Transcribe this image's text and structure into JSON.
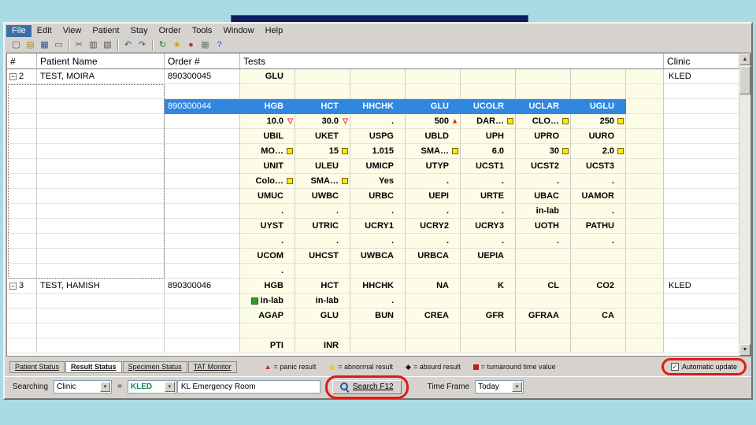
{
  "menu": {
    "items": [
      "File",
      "Edit",
      "View",
      "Patient",
      "Stay",
      "Order",
      "Tools",
      "Window",
      "Help"
    ]
  },
  "toolbar": {
    "icons": [
      {
        "name": "new-document-icon",
        "glyph": "▢",
        "color": "#555555"
      },
      {
        "name": "open-folder-icon",
        "glyph": "▤",
        "color": "#b08a2a"
      },
      {
        "name": "save-icon",
        "glyph": "▦",
        "color": "#35518c"
      },
      {
        "name": "print-icon",
        "glyph": "▭",
        "color": "#555555"
      },
      {
        "sep": true
      },
      {
        "name": "cut-icon",
        "glyph": "✂",
        "color": "#555555"
      },
      {
        "name": "copy-icon",
        "glyph": "▥",
        "color": "#555555"
      },
      {
        "name": "paste-icon",
        "glyph": "▧",
        "color": "#555555"
      },
      {
        "sep": true
      },
      {
        "name": "undo-icon",
        "glyph": "↶",
        "color": "#355a9c"
      },
      {
        "name": "redo-icon",
        "glyph": "↷",
        "color": "#355a9c"
      },
      {
        "sep": true
      },
      {
        "name": "refresh-icon",
        "glyph": "↻",
        "color": "#2a7a2a"
      },
      {
        "name": "favorites-icon",
        "glyph": "★",
        "color": "#c8a800"
      },
      {
        "name": "stop-icon",
        "glyph": "●",
        "color": "#c03030"
      },
      {
        "name": "grid-icon",
        "glyph": "▦",
        "color": "#777777"
      },
      {
        "name": "help-icon",
        "glyph": "?",
        "color": "#2255cc"
      }
    ]
  },
  "grid": {
    "headers": {
      "num": "#",
      "patient": "Patient Name",
      "order": "Order #",
      "tests": "Tests",
      "clinic": "Clinic"
    },
    "rows": [
      {
        "cells": [
          {
            "c": 0,
            "t": "2",
            "expand": true
          },
          {
            "c": 1,
            "t": "TEST, MOIRA"
          },
          {
            "c": 2,
            "t": "890300045"
          },
          {
            "c": 3,
            "t": "GLU"
          },
          {
            "c": 11,
            "t": "KLED"
          }
        ]
      },
      {
        "cells": []
      },
      {
        "hl": true,
        "cells": [
          {
            "c": 2,
            "t": "890300044"
          },
          {
            "c": 3,
            "t": "HGB"
          },
          {
            "c": 4,
            "t": "HCT"
          },
          {
            "c": 5,
            "t": "HHCHK"
          },
          {
            "c": 6,
            "t": "GLU"
          },
          {
            "c": 7,
            "t": "UCOLR"
          },
          {
            "c": 8,
            "t": "UCLAR"
          },
          {
            "c": 9,
            "t": "UGLU"
          }
        ]
      },
      {
        "cells": [
          {
            "c": 3,
            "t": "10.0",
            "m": "rdown"
          },
          {
            "c": 4,
            "t": "30.0",
            "m": "rdown"
          },
          {
            "c": 5,
            "t": "."
          },
          {
            "c": 6,
            "t": "500",
            "m": "rup"
          },
          {
            "c": 7,
            "t": "DAR…",
            "m": "ysq"
          },
          {
            "c": 8,
            "t": "CLO…",
            "m": "ysq"
          },
          {
            "c": 9,
            "t": "250",
            "m": "ysq"
          }
        ]
      },
      {
        "cells": [
          {
            "c": 3,
            "t": "UBIL"
          },
          {
            "c": 4,
            "t": "UKET"
          },
          {
            "c": 5,
            "t": "USPG"
          },
          {
            "c": 6,
            "t": "UBLD"
          },
          {
            "c": 7,
            "t": "UPH"
          },
          {
            "c": 8,
            "t": "UPRO"
          },
          {
            "c": 9,
            "t": "UURO"
          }
        ]
      },
      {
        "cells": [
          {
            "c": 3,
            "t": "MO…",
            "m": "ysq"
          },
          {
            "c": 4,
            "t": "15",
            "m": "ysq"
          },
          {
            "c": 5,
            "t": "1.015"
          },
          {
            "c": 6,
            "t": "SMA…",
            "m": "ysq"
          },
          {
            "c": 7,
            "t": "6.0"
          },
          {
            "c": 8,
            "t": "30",
            "m": "ysq"
          },
          {
            "c": 9,
            "t": "2.0",
            "m": "ysq"
          }
        ]
      },
      {
        "cells": [
          {
            "c": 3,
            "t": "UNIT"
          },
          {
            "c": 4,
            "t": "ULEU"
          },
          {
            "c": 5,
            "t": "UMICP"
          },
          {
            "c": 6,
            "t": "UTYP"
          },
          {
            "c": 7,
            "t": "UCST1"
          },
          {
            "c": 8,
            "t": "UCST2"
          },
          {
            "c": 9,
            "t": "UCST3"
          }
        ]
      },
      {
        "cells": [
          {
            "c": 3,
            "t": "Colo…",
            "m": "ysq"
          },
          {
            "c": 4,
            "t": "SMA…",
            "m": "ysq"
          },
          {
            "c": 5,
            "t": "Yes"
          },
          {
            "c": 6,
            "t": "."
          },
          {
            "c": 7,
            "t": "."
          },
          {
            "c": 8,
            "t": "."
          },
          {
            "c": 9,
            "t": "."
          }
        ]
      },
      {
        "cells": [
          {
            "c": 3,
            "t": "UMUC"
          },
          {
            "c": 4,
            "t": "UWBC"
          },
          {
            "c": 5,
            "t": "URBC"
          },
          {
            "c": 6,
            "t": "UEPI"
          },
          {
            "c": 7,
            "t": "URTE"
          },
          {
            "c": 8,
            "t": "UBAC"
          },
          {
            "c": 9,
            "t": "UAMOR"
          }
        ]
      },
      {
        "cells": [
          {
            "c": 3,
            "t": "."
          },
          {
            "c": 4,
            "t": "."
          },
          {
            "c": 5,
            "t": "."
          },
          {
            "c": 6,
            "t": "."
          },
          {
            "c": 7,
            "t": "."
          },
          {
            "c": 8,
            "t": "in-lab"
          },
          {
            "c": 9,
            "t": "."
          }
        ]
      },
      {
        "cells": [
          {
            "c": 3,
            "t": "UYST"
          },
          {
            "c": 4,
            "t": "UTRIC"
          },
          {
            "c": 5,
            "t": "UCRY1"
          },
          {
            "c": 6,
            "t": "UCRY2"
          },
          {
            "c": 7,
            "t": "UCRY3"
          },
          {
            "c": 8,
            "t": "UOTH"
          },
          {
            "c": 9,
            "t": "PATHU"
          }
        ]
      },
      {
        "cells": [
          {
            "c": 3,
            "t": "."
          },
          {
            "c": 4,
            "t": "."
          },
          {
            "c": 5,
            "t": "."
          },
          {
            "c": 6,
            "t": "."
          },
          {
            "c": 7,
            "t": "."
          },
          {
            "c": 8,
            "t": "."
          },
          {
            "c": 9,
            "t": "."
          }
        ]
      },
      {
        "cells": [
          {
            "c": 3,
            "t": "UCOM"
          },
          {
            "c": 4,
            "t": "UHCST"
          },
          {
            "c": 5,
            "t": "UWBCA"
          },
          {
            "c": 6,
            "t": "URBCA"
          },
          {
            "c": 7,
            "t": "UEPIA"
          }
        ]
      },
      {
        "cells": [
          {
            "c": 3,
            "t": "."
          }
        ]
      },
      {
        "cells": [
          {
            "c": 0,
            "t": "3",
            "expand": true
          },
          {
            "c": 1,
            "t": "TEST, HAMISH"
          },
          {
            "c": 2,
            "t": "890300046"
          },
          {
            "c": 3,
            "t": "HGB"
          },
          {
            "c": 4,
            "t": "HCT"
          },
          {
            "c": 5,
            "t": "HHCHK"
          },
          {
            "c": 6,
            "t": "NA"
          },
          {
            "c": 7,
            "t": "K"
          },
          {
            "c": 8,
            "t": "CL"
          },
          {
            "c": 9,
            "t": "CO2"
          },
          {
            "c": 11,
            "t": "KLED"
          }
        ]
      },
      {
        "cells": [
          {
            "c": 3,
            "t": "in-lab",
            "icon": "green"
          },
          {
            "c": 4,
            "t": "in-lab"
          },
          {
            "c": 5,
            "t": "."
          }
        ]
      },
      {
        "cells": [
          {
            "c": 3,
            "t": "AGAP"
          },
          {
            "c": 4,
            "t": "GLU"
          },
          {
            "c": 5,
            "t": "BUN"
          },
          {
            "c": 6,
            "t": "CREA"
          },
          {
            "c": 7,
            "t": "GFR"
          },
          {
            "c": 8,
            "t": "GFRAA"
          },
          {
            "c": 9,
            "t": "CA"
          }
        ]
      },
      {
        "cells": []
      },
      {
        "cells": [
          {
            "c": 3,
            "t": "PTI"
          },
          {
            "c": 4,
            "t": "INR"
          }
        ]
      }
    ]
  },
  "tabs": {
    "items": [
      {
        "label": "Patient Status",
        "active": false
      },
      {
        "label": "Result Status",
        "active": true
      },
      {
        "label": "Specimen Status",
        "active": false
      },
      {
        "label": "TAT Monitor",
        "active": false
      }
    ]
  },
  "legend": {
    "items": [
      {
        "icon": "panic-result-icon",
        "cls": "lm-rtri",
        "glyph": "▲",
        "text": "= panic result"
      },
      {
        "icon": "abnormal-result-icon",
        "cls": "lm-ytri",
        "glyph": "▲",
        "text": "= abnormal result"
      },
      {
        "icon": "absurd-result-icon",
        "cls": "lm-bdia",
        "glyph": "◆",
        "text": "= absurd result"
      },
      {
        "icon": "turnaround-time-icon",
        "cls": "lm-rsq",
        "glyph": "",
        "text": "= turnaround time value"
      }
    ]
  },
  "auto_update": {
    "label": "Automatic update",
    "checked": true,
    "checkmark": "✓"
  },
  "search": {
    "label": "Searching",
    "field_value": "Clinic",
    "operator": "=",
    "code_value": "KLED",
    "code_desc": "KL Emergency Room",
    "button": "Search  F12",
    "time_frame_label": "Time Frame",
    "time_frame_value": "Today"
  },
  "scrollbar": {
    "up": "▲",
    "down": "▼"
  },
  "colors": {
    "highlight_row": "#2f87e0",
    "panic": "#dd2015",
    "abnormal": "#ffe60a",
    "annotation": "#e01b14",
    "desktop": "#a9dbe5"
  }
}
